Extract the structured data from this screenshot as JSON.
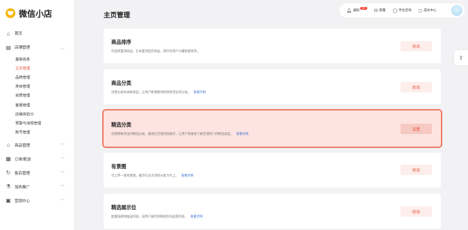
{
  "app": {
    "name": "微信小店"
  },
  "sidebar": {
    "items": [
      {
        "label": "首页",
        "icon": "home-icon"
      },
      {
        "label": "店铺管理",
        "icon": "store-icon",
        "expanded": true
      }
    ],
    "store_sub": [
      {
        "label": "基础信息",
        "active": false
      },
      {
        "label": "主页管理",
        "active": true
      },
      {
        "label": "品牌管理",
        "active": false
      },
      {
        "label": "类目管理",
        "active": false
      },
      {
        "label": "资质管理",
        "active": false
      },
      {
        "label": "客服管理",
        "active": false
      },
      {
        "label": "店铺体验分",
        "active": false
      },
      {
        "label": "预警与违规管理",
        "active": false
      },
      {
        "label": "账号管理",
        "active": false
      }
    ],
    "lower": [
      {
        "label": "商品管理",
        "icon": "bag-icon"
      },
      {
        "label": "订单/配送",
        "icon": "order-icon"
      },
      {
        "label": "售后管理",
        "icon": "aftersale-icon"
      },
      {
        "label": "加热推广",
        "icon": "promote-icon"
      },
      {
        "label": "营销中心",
        "icon": "marketing-icon"
      }
    ]
  },
  "header": {
    "title": "主页管理",
    "notify_label": "通知",
    "notify_badge": "99+",
    "service_label": "客服",
    "consult_label": "平台咨询",
    "growth_label": "成长中心"
  },
  "cards": [
    {
      "title": "商品排序",
      "desc": "可选择置顶商品，在本置顶区的商品，将针对用户兴趣智能排序。",
      "link": "",
      "button": "修改",
      "highlight": false
    },
    {
      "title": "商品分类",
      "desc": "创建分类并关联商品，让用户能便捷地找到想浏览的分类。",
      "link": "查看示例",
      "button": "修改",
      "highlight": false
    },
    {
      "title": "精选分类",
      "desc": "创建想要突出的精选分类，展现在店铺顶部展示，让用户快速地了解店铺热门的精选类型。",
      "link": "查看示例",
      "button": "设置",
      "highlight": true
    },
    {
      "title": "有景图",
      "desc": "可上传一张背景图，展示在主页顶部分类卡片上。",
      "link": "查看示例",
      "button": "修改",
      "highlight": false
    },
    {
      "title": "精选展示位",
      "desc": "配置链接和推送内容，向用户展示你精选的商品或内容。",
      "link": "查看示例",
      "button": "修改",
      "highlight": false
    }
  ],
  "float_icon": "share-icon"
}
